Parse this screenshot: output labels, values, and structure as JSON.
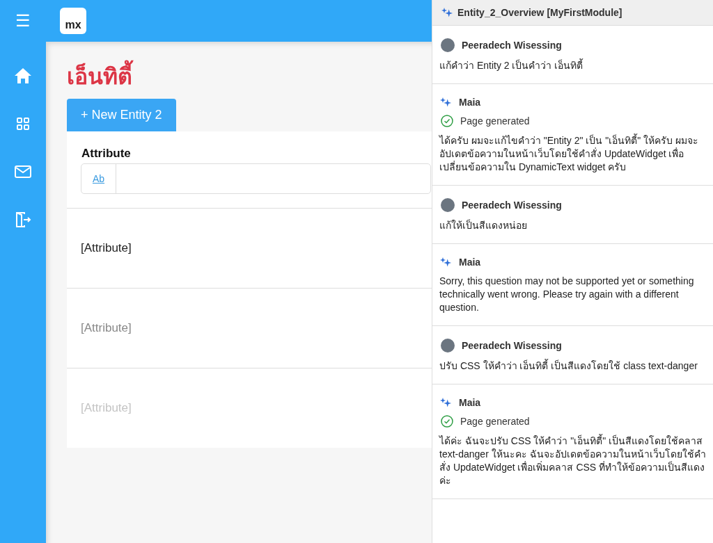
{
  "top_bar": {
    "logo": "mx",
    "menu_icon": "☰"
  },
  "page": {
    "title": "เอ็นทิตี้",
    "new_button": "+ New Entity 2",
    "filter": {
      "label": "Attribute",
      "toggle": "Ab"
    },
    "rows": [
      {
        "text": "[Attribute]",
        "kind": "normal"
      },
      {
        "text": "[Attribute]",
        "kind": "muted"
      },
      {
        "text": "[Attribute]",
        "kind": "faint"
      }
    ]
  },
  "chat": {
    "title": "Entity_2_Overview [MyFirstModule]",
    "messages": [
      {
        "kind": "user",
        "author": "Peeradech Wisessing",
        "text": "แก้คำว่า Entity 2 เป็นคำว่า เอ็นทิตี้"
      },
      {
        "kind": "ai",
        "author": "Maia",
        "status": "Page generated",
        "text": "ได้ครับ ผมจะแก้ไขคำว่า \"Entity 2\" เป็น \"เอ็นทิตี้\" ให้ครับ ผมจะอัปเดตข้อความในหน้าเว็บโดยใช้คำสั่ง UpdateWidget เพื่อเปลี่ยนข้อความใน DynamicText widget ครับ"
      },
      {
        "kind": "user",
        "author": "Peeradech Wisessing",
        "text": "แก้ให้เป็นสีแดงหน่อย"
      },
      {
        "kind": "ai",
        "author": "Maia",
        "text": "Sorry, this question may not be supported yet or something technically went wrong. Please try again with a different question."
      },
      {
        "kind": "user",
        "author": "Peeradech Wisessing",
        "text": "ปรับ CSS ให้คำว่า เอ็นทิตี้ เป็นสีแดงโดยใช้ class text-danger"
      },
      {
        "kind": "ai",
        "author": "Maia",
        "status": "Page generated",
        "text": "ได้ค่ะ ฉันจะปรับ CSS ให้คำว่า \"เอ็นทิตี้\" เป็นสีแดงโดยใช้คลาส text-danger ให้นะคะ ฉันจะอัปเดตข้อความในหน้าเว็บโดยใช้คำสั่ง UpdateWidget เพื่อเพิ่มคลาส CSS ที่ทำให้ข้อความเป็นสีแดงค่ะ"
      }
    ]
  }
}
